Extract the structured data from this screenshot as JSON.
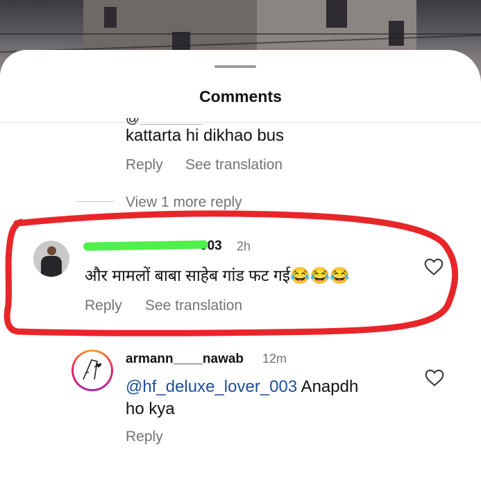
{
  "sheet": {
    "title": "Comments"
  },
  "thread": {
    "prev_reply_text": "kattarta hi dikhao bus",
    "prev_reply_actions": {
      "reply": "Reply",
      "see_translation": "See translation"
    },
    "view_more": "View 1 more reply"
  },
  "comment": {
    "username": "hf_deluxe_lover_003",
    "username_visible": "003",
    "time": "2h",
    "text": "और मामलों बाबा साहेब गांड फट गई😂😂😂",
    "reply": "Reply",
    "see_translation": "See translation"
  },
  "reply": {
    "username": "armann____nawab",
    "time": "12m",
    "mention": "@hf_deluxe_lover_003",
    "text_line1": "Anapdh",
    "text_line2": "ho kya",
    "reply": "Reply"
  },
  "colors": {
    "annotation": "#e8262a",
    "mention": "#1e4d9b",
    "scribble": "#4ff04b"
  },
  "icons": [
    "heart-icon",
    "avatar"
  ]
}
